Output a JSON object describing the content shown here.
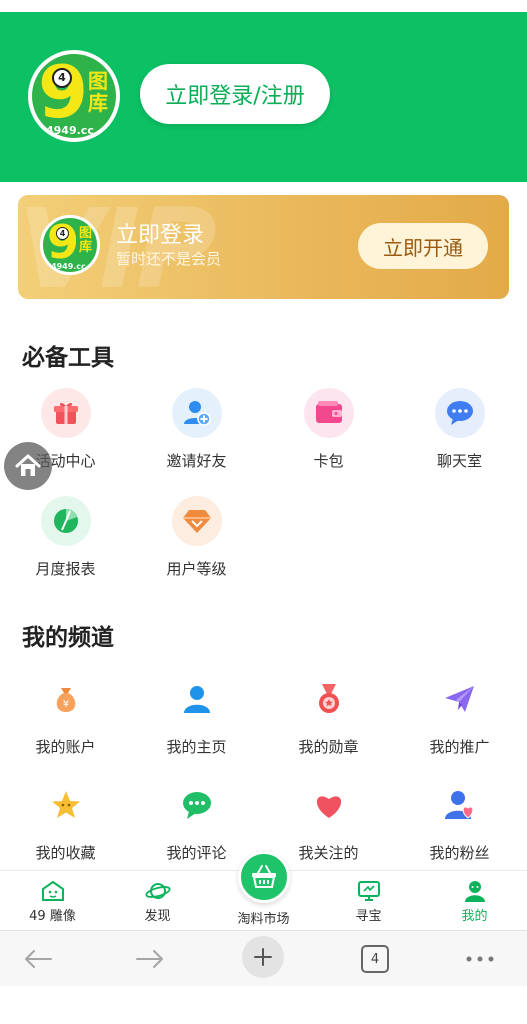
{
  "header": {
    "logo": {
      "big_char": "9",
      "ball_num": "4",
      "side_text": "图库",
      "domain": "4949.cc"
    },
    "login_button": "立即登录/注册"
  },
  "vip_card": {
    "logo": {
      "big_char": "9",
      "ball_num": "4",
      "side_text": "图库",
      "domain": "4949.cc"
    },
    "watermark": "VIP",
    "title": "立即登录",
    "subtitle": "暂时还不是会员",
    "button": "立即开通"
  },
  "tools_section": {
    "title": "必备工具",
    "items": [
      {
        "label": "活动中心",
        "icon": "gift-icon"
      },
      {
        "label": "邀请好友",
        "icon": "add-user-icon"
      },
      {
        "label": "卡包",
        "icon": "wallet-icon"
      },
      {
        "label": "聊天室",
        "icon": "chat-bubble-icon"
      },
      {
        "label": "月度报表",
        "icon": "pie-chart-icon"
      },
      {
        "label": "用户等级",
        "icon": "diamond-icon"
      }
    ]
  },
  "channel_section": {
    "title": "我的频道",
    "items": [
      {
        "label": "我的账户",
        "icon": "money-bag-icon"
      },
      {
        "label": "我的主页",
        "icon": "user-icon"
      },
      {
        "label": "我的勋章",
        "icon": "medal-icon"
      },
      {
        "label": "我的推广",
        "icon": "paper-plane-icon"
      },
      {
        "label": "我的收藏",
        "icon": "star-icon"
      },
      {
        "label": "我的评论",
        "icon": "comment-icon"
      },
      {
        "label": "我关注的",
        "icon": "heart-icon"
      },
      {
        "label": "我的粉丝",
        "icon": "fans-icon"
      }
    ]
  },
  "bottom_nav": {
    "items": [
      {
        "label": "49 雕像",
        "icon": "statue-icon"
      },
      {
        "label": "发现",
        "icon": "planet-icon"
      },
      {
        "label": "淘料市场",
        "icon": "basket-icon"
      },
      {
        "label": "寻宝",
        "icon": "monitor-icon"
      },
      {
        "label": "我的",
        "icon": "profile-icon",
        "active": true
      }
    ]
  },
  "browser_bar": {
    "tab_count": "4"
  },
  "colors": {
    "brand_green": "#0cc164",
    "vip_gold": "#e9b75a",
    "active_nav": "#0cb35c"
  }
}
